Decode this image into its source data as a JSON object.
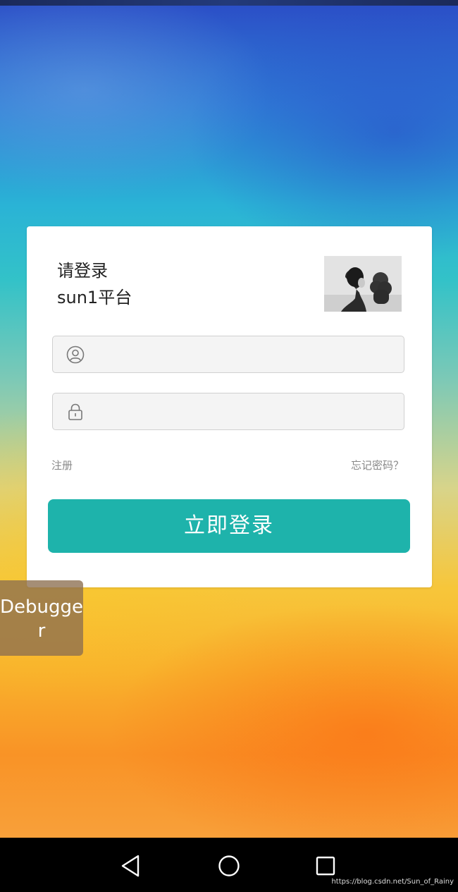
{
  "login_card": {
    "heading_line1": "请登录",
    "heading_line2": "sun1平台",
    "username_value": "",
    "password_value": "",
    "register_link": "注册",
    "forgot_link": "忘记密码？",
    "login_button": "立即登录"
  },
  "debugger_button": "Debugger",
  "nav_bar": {
    "icons": [
      "back-icon",
      "home-icon",
      "recent-apps-icon"
    ]
  },
  "watermark": "https://blog.csdn.net/Sun_of_Rainy",
  "colors": {
    "accent": "#1eb3ab",
    "card": "#ffffff",
    "field_bg": "#f4f4f4",
    "debugger_bg": "#8c6e50"
  }
}
